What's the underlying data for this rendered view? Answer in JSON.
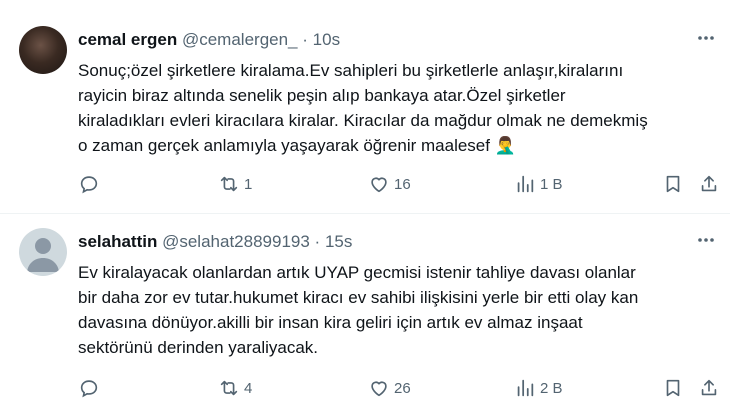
{
  "tweets": [
    {
      "name": "cemal ergen",
      "handle": "@cemalergen_",
      "separator": "·",
      "time": "10s",
      "text": "Sonuç;özel şirketlere kiralama.Ev sahipleri bu şirketlerle anlaşır,kiralarını\nrayicin biraz altında senelik peşin alıp bankaya atar.Özel şirketler\nkiraladıkları evleri kiracılara kiralar. Kiracılar da mağdur olmak ne demekmiş\no zaman gerçek anlamıyla yaşayarak öğrenir maalesef 🤦‍♂️",
      "replies": "",
      "retweets": "1",
      "likes": "16",
      "views": "1 B"
    },
    {
      "name": "selahattin",
      "handle": "@selahat28899193",
      "separator": "·",
      "time": "15s",
      "text": "Ev kiralayacak olanlardan artık UYAP gecmisi istenir tahliye davası olanlar\nbir daha zor ev tutar.hukumet kiracı ev sahibi ilişkisini yerle bir etti olay kan\ndavasına dönüyor.akilli bir insan kira geliri için artık ev almaz inşaat\nsektörünü derinden yaraliyacak.",
      "replies": "",
      "retweets": "4",
      "likes": "26",
      "views": "2 B"
    }
  ],
  "icons": {
    "more": "more-icon",
    "reply": "reply-icon",
    "retweet": "retweet-icon",
    "like": "heart-icon",
    "views": "views-icon",
    "bookmark": "bookmark-icon",
    "share": "share-icon"
  },
  "colors": {
    "text": "#0f1419",
    "muted": "#536471",
    "divider": "#eff3f4"
  }
}
